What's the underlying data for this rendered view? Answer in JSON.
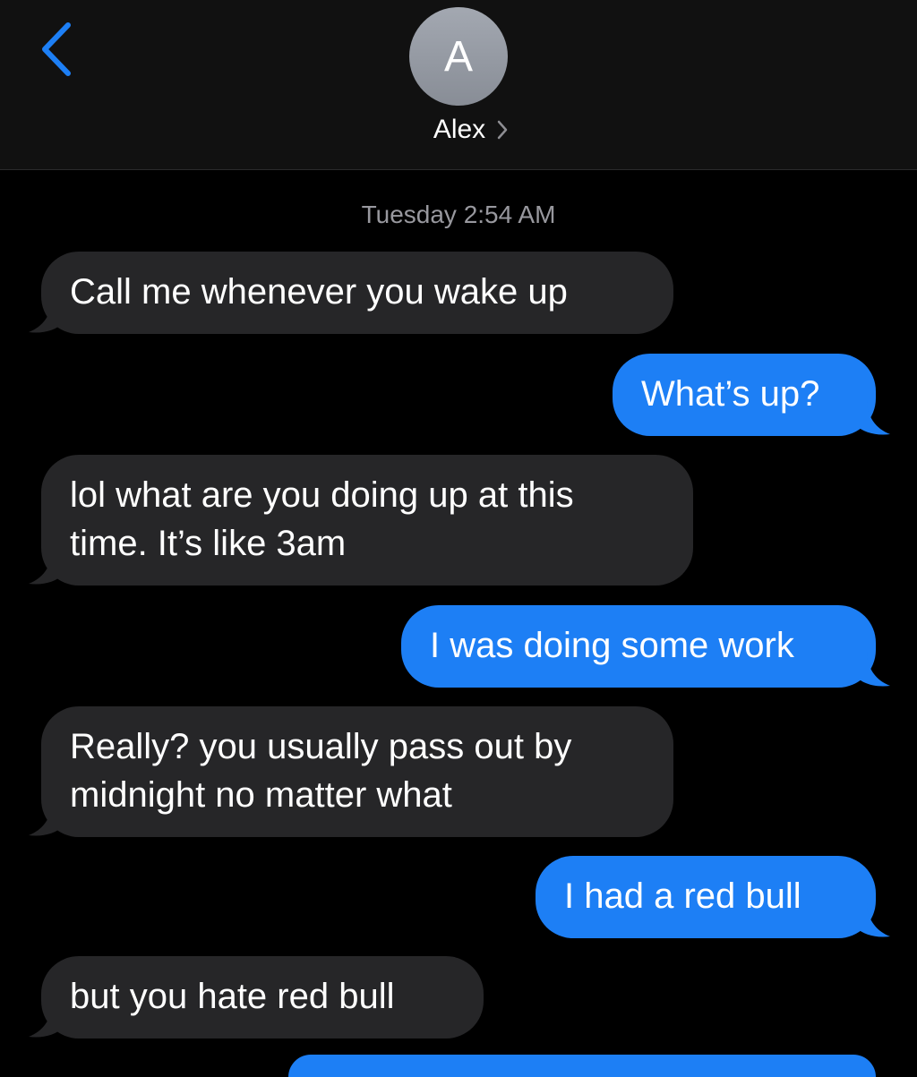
{
  "header": {
    "avatar_initial": "A",
    "contact_name": "Alex"
  },
  "thread": {
    "timestamp": "Tuesday 2:54 AM",
    "messages": [
      {
        "direction": "incoming",
        "text": "Call me whenever you wake up"
      },
      {
        "direction": "outgoing",
        "text": "What’s up?"
      },
      {
        "direction": "incoming",
        "text": "lol what are you doing up at this\ntime. It’s like 3am"
      },
      {
        "direction": "outgoing",
        "text": "I was doing some work"
      },
      {
        "direction": "incoming",
        "text": "Really? you usually pass out by\nmidnight no matter what"
      },
      {
        "direction": "outgoing",
        "text": "I had a red bull"
      },
      {
        "direction": "incoming",
        "text": "but you hate red bull"
      }
    ]
  },
  "colors": {
    "background": "#000000",
    "header_background": "#111111",
    "incoming_bubble": "#262628",
    "outgoing_bubble": "#1d7ff5",
    "accent": "#1d7ff5",
    "timestamp_text": "#98989e"
  },
  "icons": {
    "back": "chevron-left-icon",
    "contact_detail": "chevron-right-icon"
  }
}
